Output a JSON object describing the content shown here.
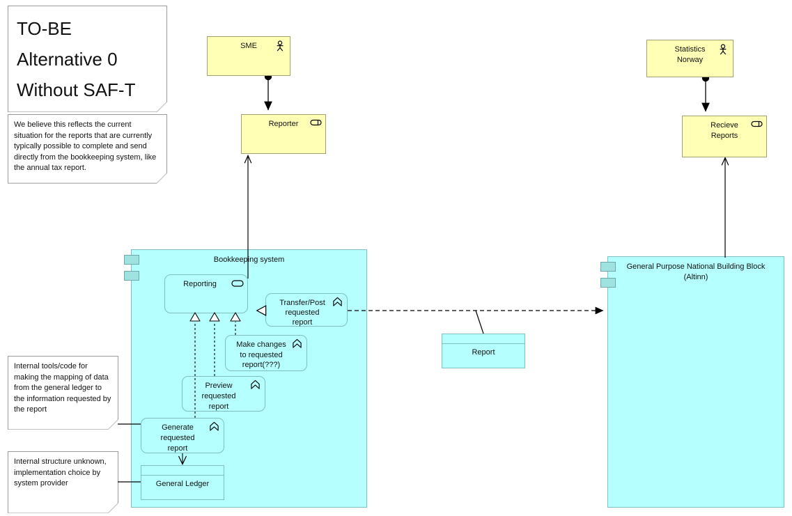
{
  "title_note": {
    "lines": [
      "TO-BE",
      "Alternative 0",
      "Without SAF-T"
    ]
  },
  "notes": [
    {
      "id": "note-current-situation",
      "text": "We believe this reflects the current situation for the reports that are currently typically possible to complete and send directly from the bookkeeping system, like the annual tax report."
    },
    {
      "id": "note-internal-tools",
      "text": "Internal tools/code for making the mapping of data from the general ledger to the information requested by the report"
    },
    {
      "id": "note-internal-structure",
      "text": "Internal structure unknown, implementation choice by system provider"
    }
  ],
  "actors": [
    {
      "id": "sme",
      "label": "SME",
      "icon": "business-actor-icon"
    },
    {
      "id": "statistics-norway",
      "label": "Statistics\nNorway",
      "icon": "business-actor-icon"
    }
  ],
  "roles": [
    {
      "id": "reporter",
      "label": "Reporter",
      "icon": "business-role-icon"
    },
    {
      "id": "recieve-reports",
      "label": "Recieve\nReports",
      "icon": "business-role-icon"
    }
  ],
  "containers": [
    {
      "id": "bookkeeping-system",
      "label": "Bookkeeping system",
      "icon": "application-component-icon"
    },
    {
      "id": "altinn",
      "label": "General Purpose National Building Block\n(Altinn)",
      "icon": "application-component-icon"
    }
  ],
  "application_service": {
    "id": "reporting",
    "label": "Reporting",
    "icon": "application-service-icon"
  },
  "application_functions": [
    {
      "id": "transfer-post-requested-report",
      "label": "Transfer/Post\nrequested\nreport",
      "icon": "application-function-icon"
    },
    {
      "id": "make-changes-to-requested-report",
      "label": "Make changes\nto requested\nreport(???)",
      "icon": "application-function-icon"
    },
    {
      "id": "preview-requested-report",
      "label": "Preview\nrequested\nreport",
      "icon": "application-function-icon"
    },
    {
      "id": "generate-requested-report",
      "label": "Generate\nrequested\nreport",
      "icon": "application-function-icon"
    }
  ],
  "data_objects": [
    {
      "id": "general-ledger",
      "label": "General Ledger"
    },
    {
      "id": "report",
      "label": "Report"
    }
  ],
  "colors": {
    "business_yellow": "#ffffb5",
    "application_cyan": "#b5ffff",
    "note_white": "#ffffff",
    "line": "#000000",
    "node_border": "#8f8f8f"
  }
}
